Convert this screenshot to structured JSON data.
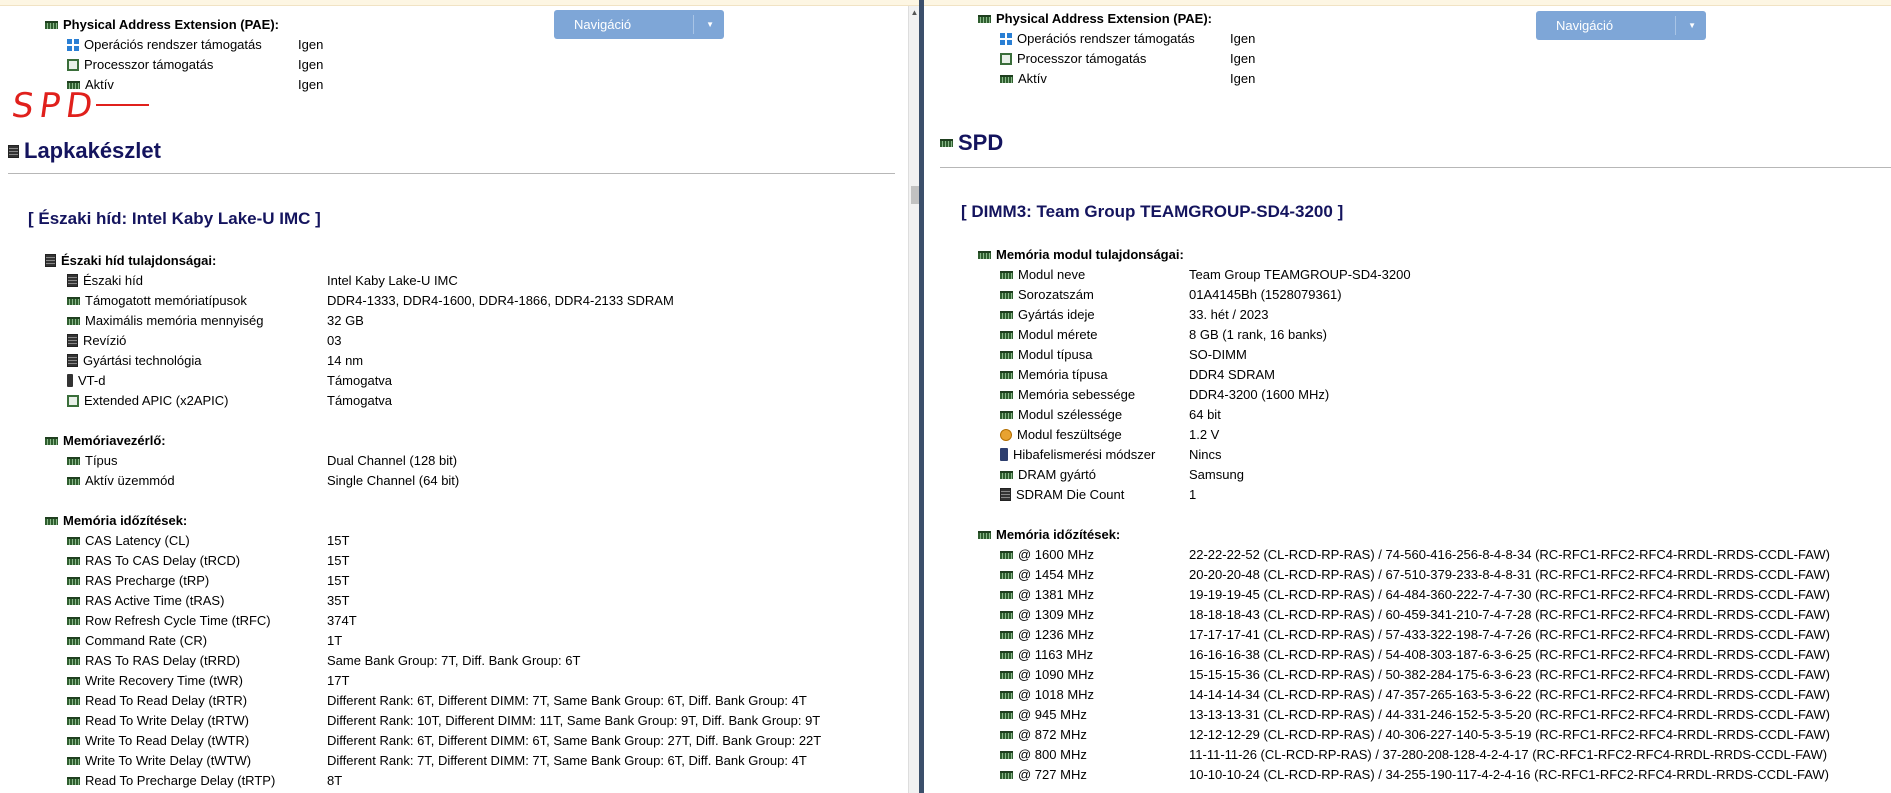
{
  "left": {
    "nav_label": "Navigáció",
    "pae": {
      "title": "Physical Address Extension (PAE):",
      "rows": [
        {
          "label": "Operációs rendszer támogatás",
          "value": "Igen",
          "icon": "windows-icon"
        },
        {
          "label": "Processzor támogatás",
          "value": "Igen",
          "icon": "cpu-icon"
        },
        {
          "label": "Aktív",
          "value": "Igen",
          "icon": "ram-icon"
        }
      ]
    },
    "annotation": "SPD",
    "section_title": "Lapkakészlet",
    "subsection_title": "[ Északi híd: Intel Kaby Lake-U IMC ]",
    "northbridge": {
      "title": "Északi híd tulajdonságai:",
      "rows": [
        {
          "label": "Északi híd",
          "value": "Intel Kaby Lake-U IMC",
          "icon": "chip-icon"
        },
        {
          "label": "Támogatott memóriatípusok",
          "value": "DDR4-1333, DDR4-1600, DDR4-1866, DDR4-2133 SDRAM",
          "icon": "ram-icon"
        },
        {
          "label": "Maximális memória mennyiség",
          "value": "32 GB",
          "icon": "ram-icon"
        },
        {
          "label": "Revízió",
          "value": "03",
          "icon": "chip-icon"
        },
        {
          "label": "Gyártási technológia",
          "value": "14 nm",
          "icon": "chip-icon"
        },
        {
          "label": "VT-d",
          "value": "Támogatva",
          "icon": "vt-icon"
        },
        {
          "label": "Extended APIC (x2APIC)",
          "value": "Támogatva",
          "icon": "cpu-icon"
        }
      ]
    },
    "memctrl": {
      "title": "Memóriavezérlő:",
      "rows": [
        {
          "label": "Típus",
          "value": "Dual Channel  (128 bit)",
          "icon": "ram-icon"
        },
        {
          "label": "Aktív üzemmód",
          "value": "Single Channel  (64 bit)",
          "icon": "ram-icon"
        }
      ]
    },
    "timings": {
      "title": "Memória időzítések:",
      "rows": [
        {
          "label": "CAS Latency (CL)",
          "value": "15T"
        },
        {
          "label": "RAS To CAS Delay (tRCD)",
          "value": "15T"
        },
        {
          "label": "RAS Precharge (tRP)",
          "value": "15T"
        },
        {
          "label": "RAS Active Time (tRAS)",
          "value": "35T"
        },
        {
          "label": "Row Refresh Cycle Time (tRFC)",
          "value": "374T"
        },
        {
          "label": "Command Rate (CR)",
          "value": "1T"
        },
        {
          "label": "RAS To RAS Delay (tRRD)",
          "value": "Same Bank Group: 7T, Diff. Bank Group: 6T"
        },
        {
          "label": "Write Recovery Time (tWR)",
          "value": "17T"
        },
        {
          "label": "Read To Read Delay (tRTR)",
          "value": "Different Rank: 6T, Different DIMM: 7T, Same Bank Group: 6T, Diff. Bank Group: 4T"
        },
        {
          "label": "Read To Write Delay (tRTW)",
          "value": "Different Rank: 10T, Different DIMM: 11T, Same Bank Group: 9T, Diff. Bank Group: 9T"
        },
        {
          "label": "Write To Read Delay (tWTR)",
          "value": "Different Rank: 6T, Different DIMM: 6T, Same Bank Group: 27T, Diff. Bank Group: 22T"
        },
        {
          "label": "Write To Write Delay (tWTW)",
          "value": "Different Rank: 7T, Different DIMM: 7T, Same Bank Group: 6T, Diff. Bank Group: 4T"
        },
        {
          "label": "Read To Precharge Delay (tRTP)",
          "value": "8T"
        }
      ]
    }
  },
  "right": {
    "nav_label": "Navigáció",
    "pae": {
      "title": "Physical Address Extension (PAE):",
      "rows": [
        {
          "label": "Operációs rendszer támogatás",
          "value": "Igen",
          "icon": "windows-icon"
        },
        {
          "label": "Processzor támogatás",
          "value": "Igen",
          "icon": "cpu-icon"
        },
        {
          "label": "Aktív",
          "value": "Igen",
          "icon": "ram-icon"
        }
      ]
    },
    "section_title": "SPD",
    "subsection_title": "[ DIMM3: Team Group TEAMGROUP-SD4-3200 ]",
    "module": {
      "title": "Memória modul tulajdonságai:",
      "rows": [
        {
          "label": "Modul neve",
          "value": "Team Group TEAMGROUP-SD4-3200",
          "icon": "ram-icon"
        },
        {
          "label": "Sorozatszám",
          "value": "01A4145Bh (1528079361)",
          "icon": "ram-icon"
        },
        {
          "label": "Gyártás ideje",
          "value": "33. hét / 2023",
          "icon": "ram-icon"
        },
        {
          "label": "Modul mérete",
          "value": "8 GB (1 rank, 16 banks)",
          "icon": "ram-icon"
        },
        {
          "label": "Modul típusa",
          "value": "SO-DIMM",
          "icon": "ram-icon"
        },
        {
          "label": "Memória típusa",
          "value": "DDR4 SDRAM",
          "icon": "ram-icon"
        },
        {
          "label": "Memória sebessége",
          "value": "DDR4-3200 (1600 MHz)",
          "icon": "ram-icon"
        },
        {
          "label": "Modul szélessége",
          "value": "64 bit",
          "icon": "ram-icon"
        },
        {
          "label": "Modul feszültsége",
          "value": "1.2 V",
          "icon": "voltage-icon"
        },
        {
          "label": "Hibafelismerési módszer",
          "value": "Nincs",
          "icon": "ecc-icon"
        },
        {
          "label": "DRAM gyártó",
          "value": "Samsung",
          "icon": "ram-icon"
        },
        {
          "label": "SDRAM Die Count",
          "value": "1",
          "icon": "chip-icon"
        }
      ]
    },
    "timings": {
      "title": "Memória időzítések:",
      "rows": [
        {
          "label": "@ 1600 MHz",
          "value": "22-22-22-52  (CL-RCD-RP-RAS) / 74-560-416-256-8-4-8-34  (RC-RFC1-RFC2-RFC4-RRDL-RRDS-CCDL-FAW)"
        },
        {
          "label": "@ 1454 MHz",
          "value": "20-20-20-48  (CL-RCD-RP-RAS) / 67-510-379-233-8-4-8-31  (RC-RFC1-RFC2-RFC4-RRDL-RRDS-CCDL-FAW)"
        },
        {
          "label": "@ 1381 MHz",
          "value": "19-19-19-45  (CL-RCD-RP-RAS) / 64-484-360-222-7-4-7-30  (RC-RFC1-RFC2-RFC4-RRDL-RRDS-CCDL-FAW)"
        },
        {
          "label": "@ 1309 MHz",
          "value": "18-18-18-43  (CL-RCD-RP-RAS) / 60-459-341-210-7-4-7-28  (RC-RFC1-RFC2-RFC4-RRDL-RRDS-CCDL-FAW)"
        },
        {
          "label": "@ 1236 MHz",
          "value": "17-17-17-41  (CL-RCD-RP-RAS) / 57-433-322-198-7-4-7-26  (RC-RFC1-RFC2-RFC4-RRDL-RRDS-CCDL-FAW)"
        },
        {
          "label": "@ 1163 MHz",
          "value": "16-16-16-38  (CL-RCD-RP-RAS) / 54-408-303-187-6-3-6-25  (RC-RFC1-RFC2-RFC4-RRDL-RRDS-CCDL-FAW)"
        },
        {
          "label": "@ 1090 MHz",
          "value": "15-15-15-36  (CL-RCD-RP-RAS) / 50-382-284-175-6-3-6-23  (RC-RFC1-RFC2-RFC4-RRDL-RRDS-CCDL-FAW)"
        },
        {
          "label": "@ 1018 MHz",
          "value": "14-14-14-34  (CL-RCD-RP-RAS) / 47-357-265-163-5-3-6-22  (RC-RFC1-RFC2-RFC4-RRDL-RRDS-CCDL-FAW)"
        },
        {
          "label": "@ 945 MHz",
          "value": "13-13-13-31  (CL-RCD-RP-RAS) / 44-331-246-152-5-3-5-20  (RC-RFC1-RFC2-RFC4-RRDL-RRDS-CCDL-FAW)"
        },
        {
          "label": "@ 872 MHz",
          "value": "12-12-12-29  (CL-RCD-RP-RAS) / 40-306-227-140-5-3-5-19  (RC-RFC1-RFC2-RFC4-RRDL-RRDS-CCDL-FAW)"
        },
        {
          "label": "@ 800 MHz",
          "value": "11-11-11-26  (CL-RCD-RP-RAS) / 37-280-208-128-4-2-4-17  (RC-RFC1-RFC2-RFC4-RRDL-RRDS-CCDL-FAW)"
        },
        {
          "label": "@ 727 MHz",
          "value": "10-10-10-24  (CL-RCD-RP-RAS) / 34-255-190-117-4-2-4-16  (RC-RFC1-RFC2-RFC4-RRDL-RRDS-CCDL-FAW)"
        }
      ]
    }
  }
}
